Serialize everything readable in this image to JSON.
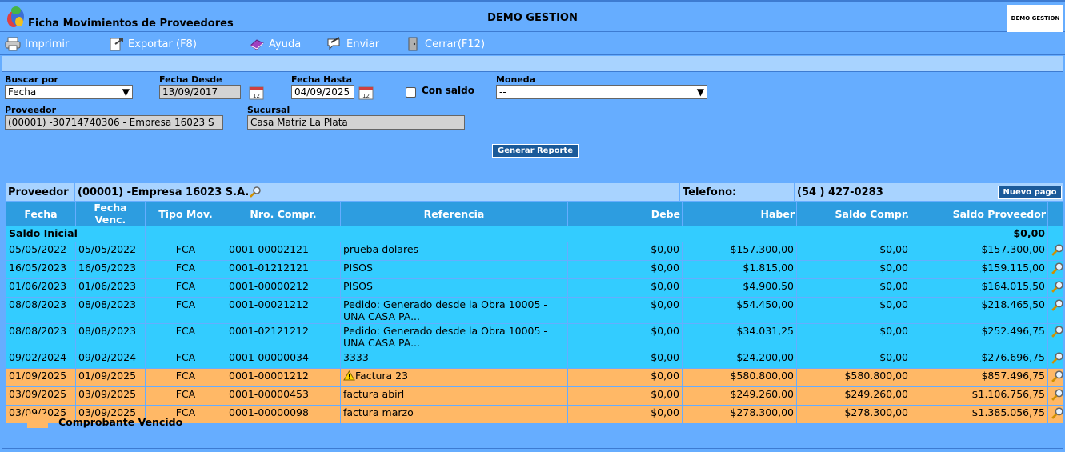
{
  "window": {
    "title": "Ficha Movimientos de Proveedores",
    "company": "DEMO GESTION",
    "brand_box": "DEMO GESTION"
  },
  "toolbar": {
    "print": "Imprimir",
    "export": "Exportar (F8)",
    "help": "Ayuda",
    "send": "Enviar",
    "close": "Cerrar(F12)"
  },
  "filters": {
    "buscar_por_label": "Buscar por",
    "buscar_por_value": "Fecha",
    "fecha_desde_label": "Fecha Desde",
    "fecha_desde_value": "13/09/2017",
    "fecha_hasta_label": "Fecha Hasta",
    "fecha_hasta_value": "04/09/2025",
    "con_saldo_label": "Con saldo",
    "moneda_label": "Moneda",
    "moneda_value": "--",
    "proveedor_label": "Proveedor",
    "proveedor_value": "(00001) -30714740306 - Empresa 16023 S",
    "sucursal_label": "Sucursal",
    "sucursal_value": "Casa Matriz La Plata",
    "generate_button": "Generar Reporte"
  },
  "provider_bar": {
    "label": "Proveedor",
    "value": "(00001) -Empresa 16023 S.A.",
    "phone_label": "Telefono:",
    "phone_value": "(54 ) 427-0283",
    "new_payment_button": "Nuevo pago"
  },
  "table": {
    "headers": [
      "Fecha",
      "Fecha Venc.",
      "Tipo Mov.",
      "Nro. Compr.",
      "Referencia",
      "Debe",
      "Haber",
      "Saldo Compr.",
      "Saldo Proveedor"
    ],
    "initial_label": "Saldo Inicial",
    "initial_value": "$0,00",
    "rows": [
      {
        "fecha": "05/05/2022",
        "venc": "05/05/2022",
        "tipo": "FCA",
        "nro": "0001-00002121",
        "ref": "prueba dolares",
        "debe": "$0,00",
        "haber": "$157.300,00",
        "saldo_compr": "$0,00",
        "saldo_prov": "$157.300,00",
        "overdue": false,
        "warning": false
      },
      {
        "fecha": "16/05/2023",
        "venc": "16/05/2023",
        "tipo": "FCA",
        "nro": "0001-01212121",
        "ref": "PISOS",
        "debe": "$0,00",
        "haber": "$1.815,00",
        "saldo_compr": "$0,00",
        "saldo_prov": "$159.115,00",
        "overdue": false,
        "warning": false
      },
      {
        "fecha": "01/06/2023",
        "venc": "01/06/2023",
        "tipo": "FCA",
        "nro": "0001-00000212",
        "ref": "PISOS",
        "debe": "$0,00",
        "haber": "$4.900,50",
        "saldo_compr": "$0,00",
        "saldo_prov": "$164.015,50",
        "overdue": false,
        "warning": false
      },
      {
        "fecha": "08/08/2023",
        "venc": "08/08/2023",
        "tipo": "FCA",
        "nro": "0001-00021212",
        "ref": "Pedido: Generado desde la Obra 10005 - UNA CASA PA...",
        "debe": "$0,00",
        "haber": "$54.450,00",
        "saldo_compr": "$0,00",
        "saldo_prov": "$218.465,50",
        "overdue": false,
        "warning": false
      },
      {
        "fecha": "08/08/2023",
        "venc": "08/08/2023",
        "tipo": "FCA",
        "nro": "0001-02121212",
        "ref": "Pedido: Generado desde la Obra 10005 - UNA CASA PA...",
        "debe": "$0,00",
        "haber": "$34.031,25",
        "saldo_compr": "$0,00",
        "saldo_prov": "$252.496,75",
        "overdue": false,
        "warning": false
      },
      {
        "fecha": "09/02/2024",
        "venc": "09/02/2024",
        "tipo": "FCA",
        "nro": "0001-00000034",
        "ref": "3333",
        "debe": "$0,00",
        "haber": "$24.200,00",
        "saldo_compr": "$0,00",
        "saldo_prov": "$276.696,75",
        "overdue": false,
        "warning": false
      },
      {
        "fecha": "01/09/2025",
        "venc": "01/09/2025",
        "tipo": "FCA",
        "nro": "0001-00001212",
        "ref": "Factura 23",
        "debe": "$0,00",
        "haber": "$580.800,00",
        "saldo_compr": "$580.800,00",
        "saldo_prov": "$857.496,75",
        "overdue": true,
        "warning": true
      },
      {
        "fecha": "03/09/2025",
        "venc": "03/09/2025",
        "tipo": "FCA",
        "nro": "0001-00000453",
        "ref": "factura abirl",
        "debe": "$0,00",
        "haber": "$249.260,00",
        "saldo_compr": "$249.260,00",
        "saldo_prov": "$1.106.756,75",
        "overdue": true,
        "warning": false
      },
      {
        "fecha": "03/09/2025",
        "venc": "03/09/2025",
        "tipo": "FCA",
        "nro": "0001-00000098",
        "ref": "factura marzo",
        "debe": "$0,00",
        "haber": "$278.300,00",
        "saldo_compr": "$278.300,00",
        "saldo_prov": "$1.385.056,75",
        "overdue": true,
        "warning": false
      }
    ]
  },
  "legend": {
    "label": "Comprobante Vencido",
    "color": "#ffb866"
  },
  "colors": {
    "background": "#66adff",
    "header": "#2d9de0",
    "row": "#33ccff",
    "overdue_row": "#ffb866",
    "button": "#1a5a9a"
  }
}
